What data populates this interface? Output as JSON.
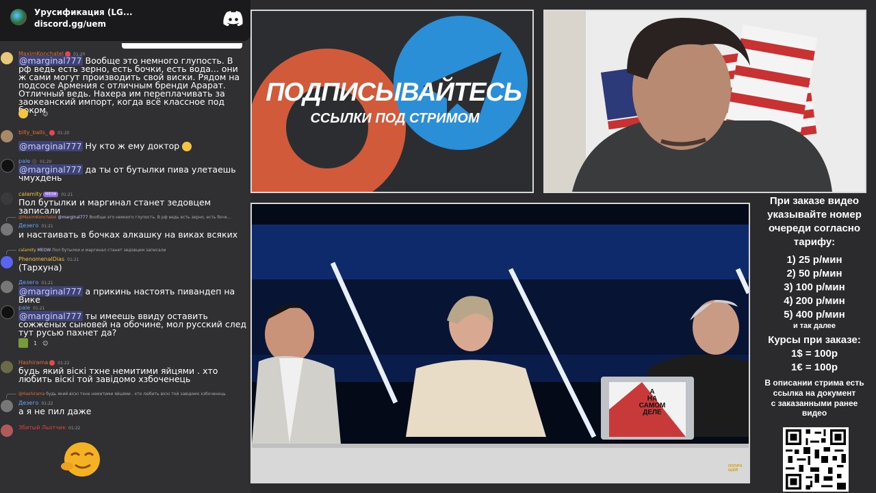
{
  "discord": {
    "server_name": "Урусификация (LG...",
    "link": "discord.gg/uem",
    "logo_icon": "discord-logo-icon"
  },
  "chat": {
    "messages": [
      {
        "user": "MaximKonchatel",
        "time": "01:20",
        "user_color": "#e0702f",
        "text_mention": "@marginal777",
        "text": " Вообще это немного глупость. В рф ведь есть зерно, есть бочки, есть вода... они ж сами могут производить свой виски. Рядом на подсосе Армения с отличным бренди Арарат. Отличный ведь. Нахера им переплачивать за заокеанский импорт, когда всё классное под боком",
        "reaction_count": "1"
      },
      {
        "user": "billy_balls_",
        "time": "01:20",
        "user_color": "#e0702f",
        "text_mention": "@marginal777",
        "text": " Ну кто ж ему доктор"
      },
      {
        "user": "pale",
        "time": "01:20",
        "user_color": "#6aa6f8",
        "text_mention": "@marginal777",
        "text": " да ты от бутылки пива улетаешь чмухдень"
      },
      {
        "user": "calamity",
        "badge": "MEOW",
        "time": "01:21",
        "user_color": "#f0c040",
        "text": "Пол бутылки и маргинал станет зедовцем записали"
      },
      {
        "reply_user": "@MaximKonchatel",
        "reply_mention": "@marginal777",
        "reply_text": " Вообще это немного глупость. В рф ведь есть зерно, есть бочк...",
        "user": "Дезего",
        "time": "01:21",
        "user_color": "#6aa6f8",
        "text": "и настаивать в бочках алкашку на виках всяких"
      },
      {
        "reply_user": "calamity",
        "reply_badge": "MEOW",
        "reply_text": "Пол бутылки и маргинал станет зедовцем записали",
        "user": "PhenomenalDias",
        "time": "01:21",
        "user_color": "#f0c040",
        "text": "(Тархуна)"
      },
      {
        "user": "Дезего",
        "time": "01:21",
        "user_color": "#6aa6f8",
        "text_mention": "@marginal777",
        "text": " а прикинь настоять пивандеп на Вике"
      },
      {
        "user": "pale",
        "time": "01:21",
        "user_color": "#6aa6f8",
        "text_mention": "@marginal777",
        "text": " ты имеешь ввиду оставить сожженых сыновей на обочине, мол русский след тут русью пахнет да?",
        "reaction_count": "1"
      },
      {
        "user": "Hashirama",
        "time": "01:22",
        "user_color": "#e0702f",
        "text": "будь який віскі тхне немитими яйцями . хто любить віскі той завідомо хзбоченець"
      },
      {
        "reply_user": "@Hashirama",
        "reply_text": "будь який віскі тхне немитими яйцями . хто любить віскі той завідомо хзбоченець",
        "user": "Дезего",
        "time": "01:22",
        "user_color": "#6aa6f8",
        "text": "а я не пил даже"
      },
      {
        "user": "Збитый Льотчик",
        "time": "01:22",
        "user_color": "#e04040",
        "text": ""
      }
    ]
  },
  "promo": {
    "title": "ПОДПИСЫВАЙТЕСЬ",
    "subtitle": "ССЫЛКИ ПОД СТРИМОМ"
  },
  "video": {
    "laptop_text_1": "А",
    "laptop_text_2": "НА",
    "laptop_text_3": "САМОМ",
    "laptop_text_4": "ДЕЛЕ",
    "logo_text": "ПОПРОЩЕЙ"
  },
  "info": {
    "lines_top": [
      "При заказе видео",
      "указывайте номер",
      "очереди согласно",
      "тарифу:"
    ],
    "tariffs": [
      "1) 25 р/мин",
      "2) 50 р/мин",
      "3) 100 р/мин",
      "4) 200 р/мин",
      "5) 400 р/мин"
    ],
    "tariffs_more": "и так далее",
    "rates_title": "Курсы при заказе:",
    "rates": [
      "1$ = 100р",
      "1€ = 100р"
    ],
    "footer": [
      "В описании стрима есть",
      "ссылка на документ",
      "с заказанными ранее",
      "видео"
    ]
  }
}
